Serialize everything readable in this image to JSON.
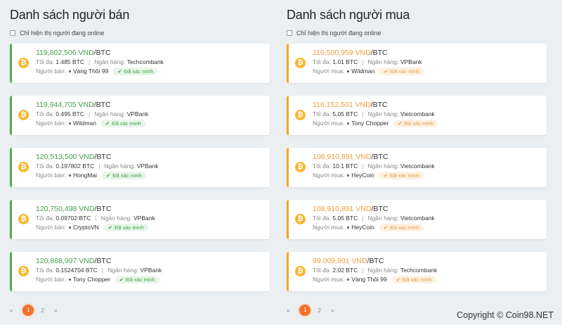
{
  "sellers": {
    "title": "Danh sách người bán",
    "online_label": "Chỉ hiện thị người đang online",
    "labels": {
      "max": "Tối đa:",
      "bank": "Ngân hàng:",
      "user": "Người bán:",
      "verified": "Đã xác minh",
      "unit": "/BTC"
    },
    "items": [
      {
        "price": "119,802,506 VND",
        "max": "1.485 BTC",
        "bank": "Techcombank",
        "user": "Vàng Thôi 99"
      },
      {
        "price": "119,944,705 VND",
        "max": "0.495 BTC",
        "bank": "VPBank",
        "user": "Wildman"
      },
      {
        "price": "120,513,500 VND",
        "max": "0.197802 BTC",
        "bank": "VPBank",
        "user": "HongMai"
      },
      {
        "price": "120,750,498 VND",
        "max": "0.09702 BTC",
        "bank": "VPBank",
        "user": "CryptoVN"
      },
      {
        "price": "120,868,997 VND",
        "max": "0.1524704 BTC",
        "bank": "VPBank",
        "user": "Tony Chopper"
      }
    ],
    "pagination": {
      "prev": "«",
      "current": "1",
      "next_page": "2",
      "next": "»"
    }
  },
  "buyers": {
    "title": "Danh sách người mua",
    "online_label": "Chỉ hiện thị người đang online",
    "labels": {
      "max": "Tối đa:",
      "bank": "Ngân hàng:",
      "user": "Người mua:",
      "verified": "Đã xác minh",
      "unit": "/BTC"
    },
    "items": [
      {
        "price": "116,500,959 VND",
        "max": "1.01 BTC",
        "bank": "VPBank",
        "user": "Wildman"
      },
      {
        "price": "116,152,501 VND",
        "max": "5.05 BTC",
        "bank": "Vietcombank",
        "user": "Tony Chopper"
      },
      {
        "price": "108,910,891 VND",
        "max": "10.1 BTC",
        "bank": "Vietcombank",
        "user": "HeyCoin"
      },
      {
        "price": "108,910,891 VND",
        "max": "5.05 BTC",
        "bank": "Vietcombank",
        "user": "HeyCoin"
      },
      {
        "price": "99,009,901 VND",
        "max": "2.02 BTC",
        "bank": "Techcombank",
        "user": "Vàng Thôi 99"
      }
    ],
    "pagination": {
      "prev": "«",
      "current": "1",
      "next_page": "2",
      "next": "»"
    }
  },
  "coin_icon": "bitcoin-icon",
  "coin_symbol": "₿",
  "check_symbol": "✔",
  "colors": {
    "seller_accent": "#43a047",
    "buyer_accent": "#f39c3a",
    "coin": "#f7b731",
    "active_page": "#f0712c"
  },
  "copyright": "Copyright © Coin98.NET"
}
